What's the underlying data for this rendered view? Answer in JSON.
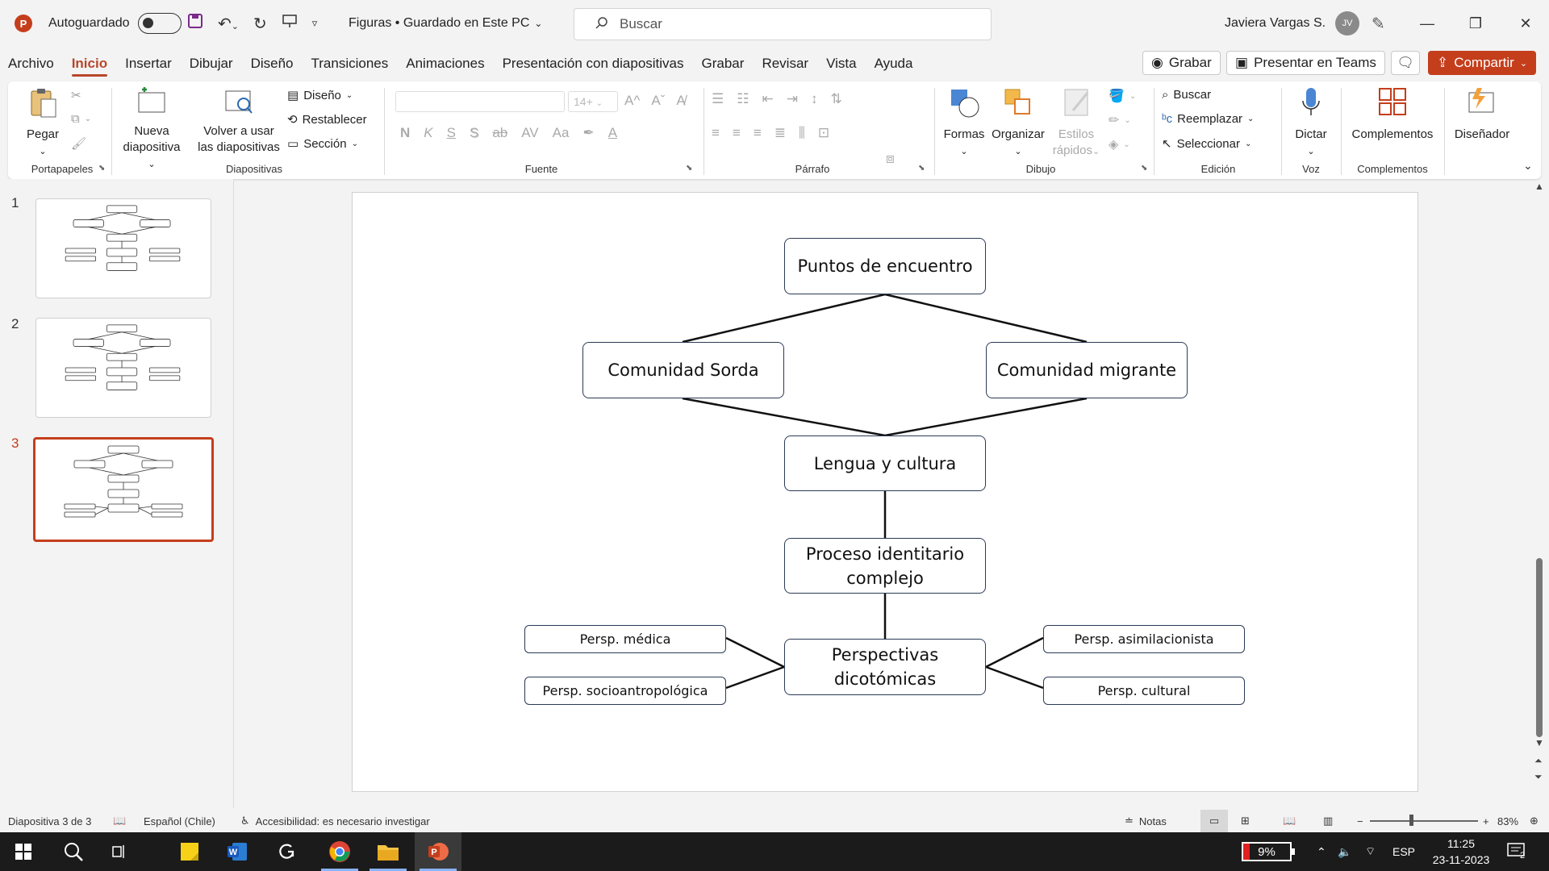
{
  "titlebar": {
    "app_logo": "P",
    "autosave_label": "Autoguardado",
    "doc_name": "Figuras • Guardado en Este PC",
    "search_placeholder": "Buscar",
    "user_name": "Javiera Vargas S.",
    "user_initials": "JV"
  },
  "menu": {
    "items": [
      "Archivo",
      "Inicio",
      "Insertar",
      "Dibujar",
      "Diseño",
      "Transiciones",
      "Animaciones",
      "Presentación con diapositivas",
      "Grabar",
      "Revisar",
      "Vista",
      "Ayuda"
    ],
    "active": "Inicio",
    "grabar_btn": "Grabar",
    "teams_btn": "Presentar en Teams",
    "share_btn": "Compartir"
  },
  "ribbon": {
    "paste": "Pegar",
    "new_slide_1": "Nueva",
    "new_slide_2": "diapositiva",
    "reuse_1": "Volver a usar",
    "reuse_2": "las diapositivas",
    "layout": "Diseño",
    "reset": "Restablecer",
    "section": "Sección",
    "font_size": "14+",
    "bold": "N",
    "italic": "K",
    "underline": "S",
    "shadow": "S",
    "strike": "ab",
    "spacing": "AV",
    "case": "Aa",
    "shapes": "Formas",
    "arrange": "Organizar",
    "quick_styles_1": "Estilos",
    "quick_styles_2": "rápidos",
    "find": "Buscar",
    "replace": "Reemplazar",
    "select": "Seleccionar",
    "dictate": "Dictar",
    "addins": "Complementos",
    "designer": "Diseñador",
    "groups": {
      "clipboard": "Portapapeles",
      "slides": "Diapositivas",
      "font": "Fuente",
      "paragraph": "Párrafo",
      "drawing": "Dibujo",
      "editing": "Edición",
      "voice": "Voz",
      "addins": "Complementos"
    }
  },
  "thumbnails": {
    "numbers": [
      "1",
      "2",
      "3"
    ],
    "active_index": 3
  },
  "slide": {
    "nodes": {
      "puntos": "Puntos de encuentro",
      "sorda": "Comunidad Sorda",
      "migrante": "Comunidad migrante",
      "lengua": "Lengua y cultura",
      "proceso_1": "Proceso identitario",
      "proceso_2": "complejo",
      "perspectivas_1": "Perspectivas",
      "perspectivas_2": "dicotómicas",
      "medica": "Persp. médica",
      "socio": "Persp. socioantropológica",
      "asimil": "Persp. asimilacionista",
      "cultural": "Persp. cultural"
    }
  },
  "statusbar": {
    "slide_info": "Diapositiva 3 de 3",
    "language": "Español (Chile)",
    "accessibility": "Accesibilidad: es necesario investigar",
    "notes": "Notas",
    "zoom": "83%"
  },
  "taskbar": {
    "battery": "9%",
    "lang": "ESP",
    "time": "11:25",
    "date": "23-11-2023",
    "notifications": "2"
  },
  "colors": {
    "accent": "#c43e1c",
    "node_border": "#2b3a55"
  }
}
